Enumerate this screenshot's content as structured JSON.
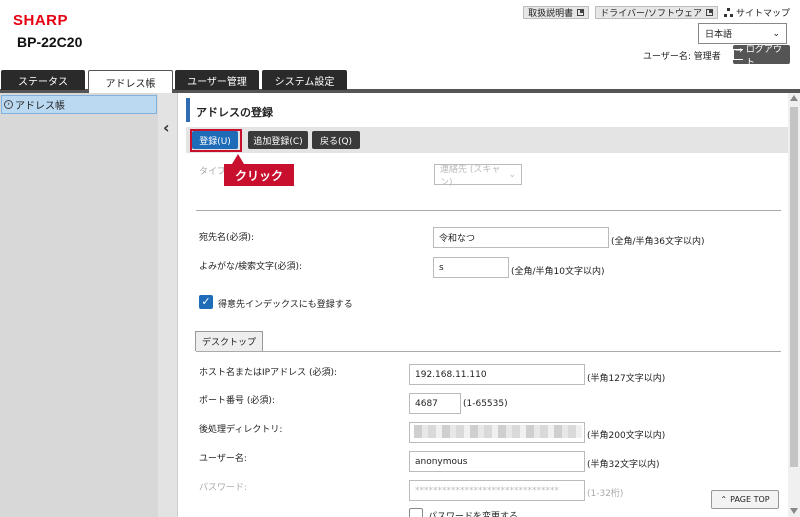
{
  "header": {
    "logo": "SHARP",
    "model": "BP-22C20",
    "links": {
      "manual": "取扱説明書",
      "driver": "ドライバー/ソフトウェア",
      "sitemap": "サイトマップ"
    },
    "language": "日本語",
    "user_label": "ユーザー名: 管理者",
    "logout": "ログアウト"
  },
  "tabs": [
    "ステータス",
    "アドレス帳",
    "ユーザー管理",
    "システム設定"
  ],
  "sidebar": {
    "item": "アドレス帳"
  },
  "page": {
    "title": "アドレスの登録",
    "buttons": {
      "register": "登録(U)",
      "add": "追加登録(C)",
      "back": "戻る(Q)"
    },
    "callout": "クリック",
    "type_label": "タイプ",
    "type_value": "連絡先 (スキャン)",
    "name_label": "宛先名(必須):",
    "name_value": "令和なつ",
    "name_hint": "(全角/半角36文字以内)",
    "kana_label": "よみがな/検索文字(必須):",
    "kana_value": "s",
    "kana_hint": "(全角/半角10文字以内)",
    "index_label": "得意先インデックスにも登録する",
    "subtab": "デスクトップ",
    "host_label": "ホスト名またはIPアドレス (必須):",
    "host_value": "192.168.11.110",
    "host_hint": "(半角127文字以内)",
    "port_label": "ポート番号 (必須):",
    "port_value": "4687",
    "port_hint": "(1-65535)",
    "dir_label": "後処理ディレクトリ:",
    "dir_hint": "(半角200文字以内)",
    "user_label": "ユーザー名:",
    "user_value": "anonymous",
    "user_hint": "(半角32文字以内)",
    "pass_label": "パスワード:",
    "pass_value": "********************************",
    "pass_hint": "(1-32桁)",
    "pass_change": "パスワードを変更する",
    "pagetop": "PAGE TOP"
  }
}
